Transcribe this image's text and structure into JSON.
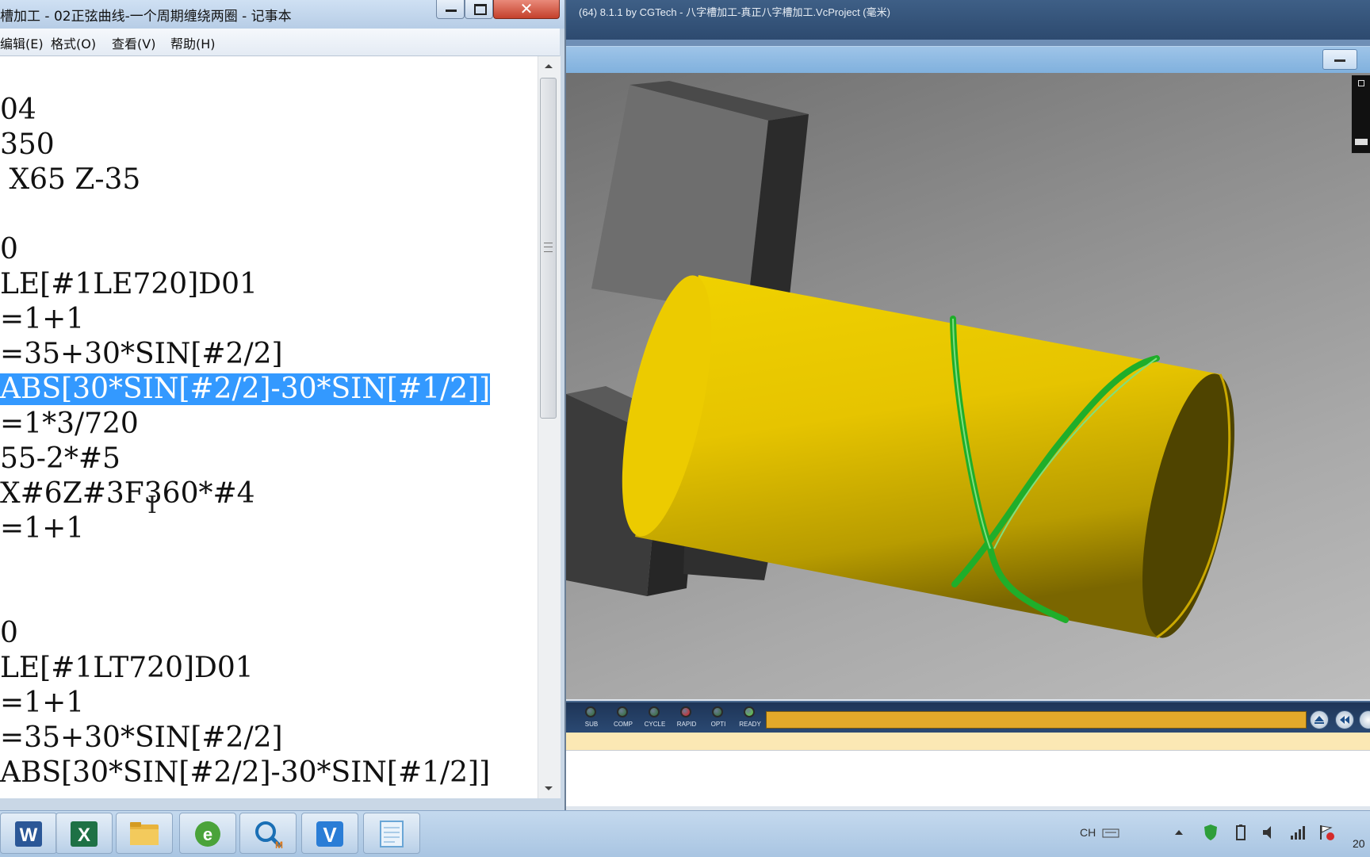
{
  "vericut": {
    "title": "(64)  8.1.1 by CGTech - 八字槽加工-真正八字槽加工.VcProject (毫米)",
    "leds": [
      {
        "label": "SUB",
        "color": "#2e6b2e"
      },
      {
        "label": "COMP",
        "color": "#2e6b2e"
      },
      {
        "label": "CYCLE",
        "color": "#2e6b2e"
      },
      {
        "label": "RAPID",
        "color": "#e01b1b"
      },
      {
        "label": "OPTI",
        "color": "#2e6b2e"
      },
      {
        "label": "READY",
        "color": "#5fd43a"
      }
    ],
    "colors": {
      "workpiece": "#e8c400",
      "groove": "#1fae2a",
      "fixture": "#3d3d3d",
      "progress": "#e3a92a"
    }
  },
  "notepad": {
    "title": "槽加工 - 02正弦曲线-一个周期缠绕两圈 - 记事本",
    "menu": [
      "编辑(E)",
      "格式(O)",
      "查看(V)",
      "帮助(H)"
    ],
    "lines": [
      "",
      "04",
      "350",
      " X65 Z-35",
      "",
      "0",
      "LE[#1LE720]D01",
      "=1+1",
      "=35+30*SIN[#2/2]",
      "ABS[30*SIN[#2/2]-30*SIN[#1/2]]",
      "=1*3/720",
      "55-2*#5",
      "X#6Z#3F360*#4",
      "=1+1",
      "",
      "",
      "0",
      "LE[#1LT720]D01",
      "=1+1",
      "=35+30*SIN[#2/2]",
      "ABS[30*SIN[#2/2]-30*SIN[#1/2]]"
    ],
    "selected_line_index": 9,
    "selection_color": "#3399ff"
  },
  "taskbar": {
    "apps": [
      {
        "name": "word-icon",
        "color": "#2b5797"
      },
      {
        "name": "excel-icon",
        "color": "#1e7145"
      },
      {
        "name": "folder-icon",
        "color": "#e8b33c"
      },
      {
        "name": "browser-icon",
        "color": "#4aa33a"
      },
      {
        "name": "mastercam-icon",
        "color": "#1a6fb5"
      },
      {
        "name": "vericut-icon",
        "color": "#2a7dd6"
      },
      {
        "name": "notepad-icon",
        "color": "#6aa6d6"
      }
    ],
    "language": "CH",
    "clock": "20"
  }
}
